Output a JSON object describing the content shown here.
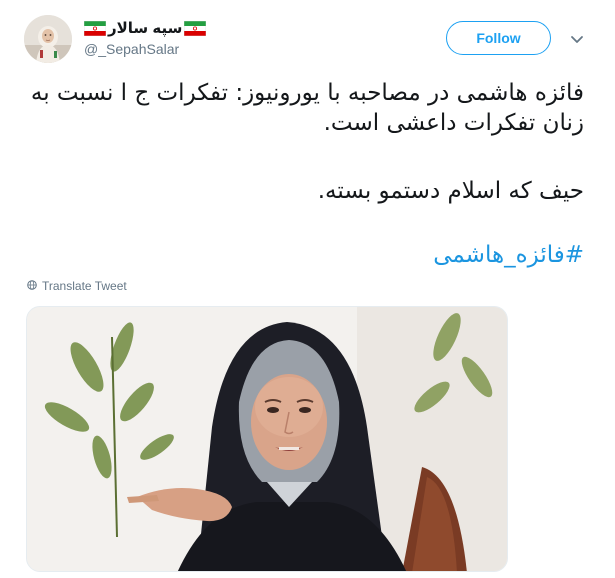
{
  "author": {
    "display_name": "سپه سالار",
    "handle": "@_SepahSalar"
  },
  "follow_button": {
    "label": "Follow"
  },
  "tweet": {
    "line1": "فائزه هاشمی در مصاحبه با یورونیوز: تفکرات ج ا نسبت به",
    "line2": "زنان تفکرات داعشی است.",
    "line3": "حیف که اسلام دستمو بسته.",
    "hashtag": "#فائزه_هاشمی"
  },
  "translate": {
    "label": "Translate Tweet"
  },
  "icons": {
    "flag": "iran-flag-icon",
    "chevron": "chevron-down-icon",
    "globe": "globe-icon"
  },
  "colors": {
    "accent": "#1da1f2",
    "hashtag": "#1b95e0",
    "secondary_text": "#657786"
  }
}
